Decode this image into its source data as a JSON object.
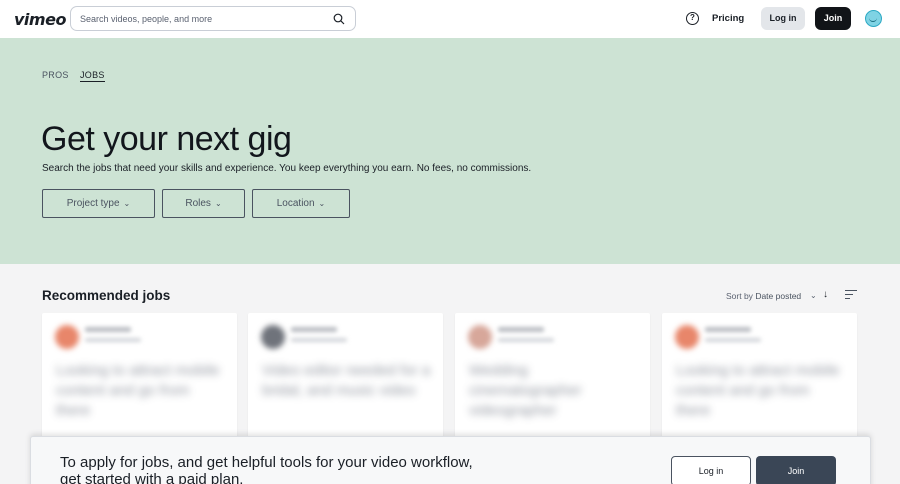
{
  "header": {
    "logo": "vimeo",
    "search_placeholder": "Search videos, people, and more",
    "help_glyph": "?",
    "pricing": "Pricing",
    "login": "Log in",
    "join": "Join"
  },
  "hero": {
    "tabs": [
      {
        "label": "PROS",
        "active": false
      },
      {
        "label": "JOBS",
        "active": true
      }
    ],
    "title": "Get your next gig",
    "subtitle": "Search the jobs that need your skills and experience. You keep everything you earn. No fees, no commissions.",
    "filters": [
      {
        "label": "Project type"
      },
      {
        "label": "Roles"
      },
      {
        "label": "Location"
      }
    ],
    "background_color": "#cde3d4"
  },
  "recommended": {
    "title": "Recommended jobs",
    "sort_label": "Sort by",
    "sort_value": "Date posted",
    "sort_direction_glyph": "↓",
    "cards": [
      {
        "avatar_color": "#e8866a",
        "text": "Looking to attract mobile content and go from there"
      },
      {
        "avatar_color": "#6f737b",
        "text": "Video editor needed for a bridal, and music video"
      },
      {
        "avatar_color": "#d7a79a",
        "text": "Wedding cinematographer videographer"
      },
      {
        "avatar_color": "#e8866a",
        "text": "Looking to attract mobile content and go from there"
      }
    ]
  },
  "cta": {
    "text": "To apply for jobs, and get helpful tools for your video workflow, get started with a paid plan.",
    "login": "Log in",
    "join": "Join"
  }
}
